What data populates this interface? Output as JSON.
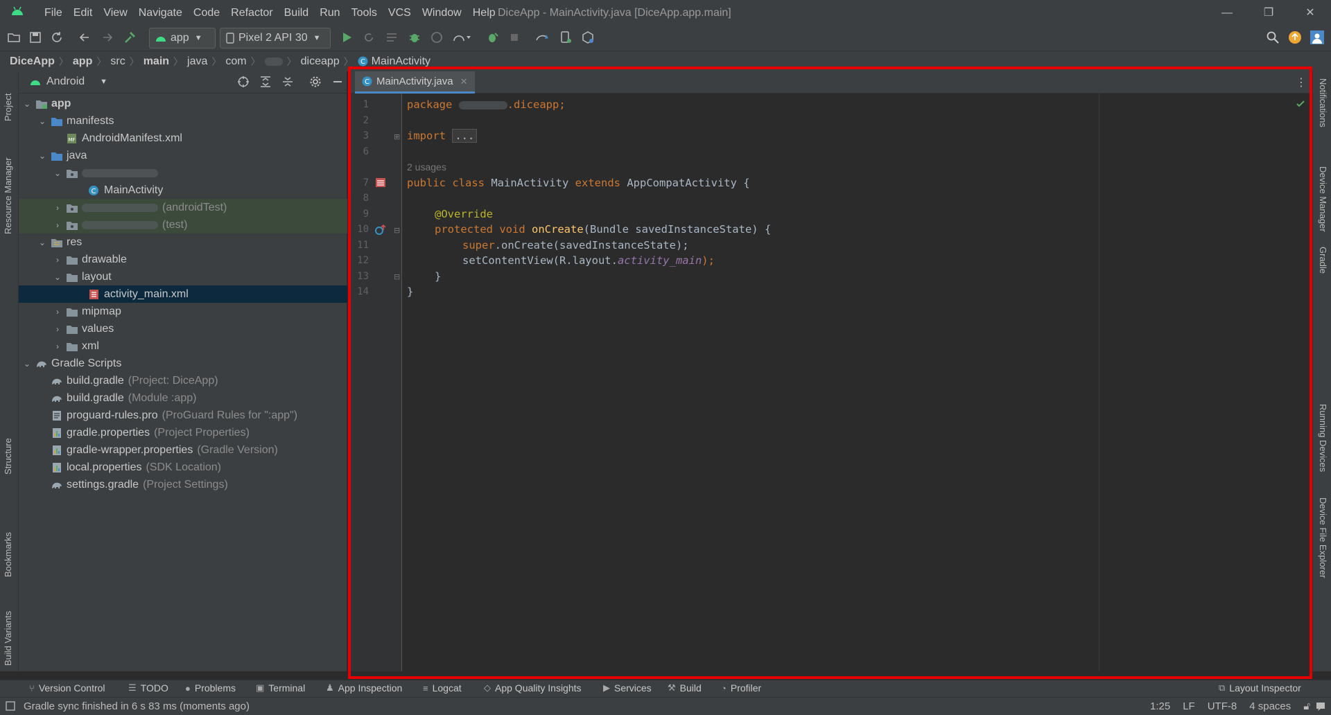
{
  "menu": [
    "File",
    "Edit",
    "View",
    "Navigate",
    "Code",
    "Refactor",
    "Build",
    "Run",
    "Tools",
    "VCS",
    "Window",
    "Help"
  ],
  "window_title": "DiceApp - MainActivity.java [DiceApp.app.main]",
  "toolbar": {
    "config": "app",
    "device": "Pixel 2 API 30"
  },
  "breadcrumb": [
    "DiceApp",
    "app",
    "src",
    "main",
    "java",
    "com",
    "",
    "diceapp",
    "MainActivity"
  ],
  "left_stripe": [
    "Project",
    "Resource Manager",
    "Structure",
    "Bookmarks",
    "Build Variants"
  ],
  "right_stripe": [
    "Notifications",
    "Device Manager",
    "Gradle",
    "Running Devices",
    "Device File Explorer"
  ],
  "project": {
    "view_label": "Android",
    "tree": [
      {
        "label": "app",
        "hint": "",
        "depth": 0
      },
      {
        "label": "manifests",
        "hint": "",
        "depth": 1
      },
      {
        "label": "AndroidManifest.xml",
        "hint": "",
        "depth": 2
      },
      {
        "label": "java",
        "hint": "",
        "depth": 1
      },
      {
        "label": "",
        "hint": "",
        "depth": 2
      },
      {
        "label": "MainActivity",
        "hint": "",
        "depth": 3
      },
      {
        "label": "",
        "hint": "(androidTest)",
        "depth": 2
      },
      {
        "label": "",
        "hint": "(test)",
        "depth": 2
      },
      {
        "label": "res",
        "hint": "",
        "depth": 1
      },
      {
        "label": "drawable",
        "hint": "",
        "depth": 2
      },
      {
        "label": "layout",
        "hint": "",
        "depth": 2
      },
      {
        "label": "activity_main.xml",
        "hint": "",
        "depth": 3
      },
      {
        "label": "mipmap",
        "hint": "",
        "depth": 2
      },
      {
        "label": "values",
        "hint": "",
        "depth": 2
      },
      {
        "label": "xml",
        "hint": "",
        "depth": 2
      },
      {
        "label": "Gradle Scripts",
        "hint": "",
        "depth": 0
      },
      {
        "label": "build.gradle",
        "hint": "(Project: DiceApp)",
        "depth": 1
      },
      {
        "label": "build.gradle",
        "hint": "(Module :app)",
        "depth": 1
      },
      {
        "label": "proguard-rules.pro",
        "hint": "(ProGuard Rules for \":app\")",
        "depth": 1
      },
      {
        "label": "gradle.properties",
        "hint": "(Project Properties)",
        "depth": 1
      },
      {
        "label": "gradle-wrapper.properties",
        "hint": "(Gradle Version)",
        "depth": 1
      },
      {
        "label": "local.properties",
        "hint": "(SDK Location)",
        "depth": 1
      },
      {
        "label": "settings.gradle",
        "hint": "(Project Settings)",
        "depth": 1
      }
    ]
  },
  "editor": {
    "tab": "MainActivity.java",
    "line_numbers": [
      "1",
      "2",
      "3",
      "6",
      "7",
      "8",
      "9",
      "10",
      "11",
      "12",
      "13",
      "14"
    ],
    "code": {
      "package_kw": "package",
      "package_rest": ".diceapp;",
      "import_kw": "import",
      "import_fold": "...",
      "usages": "2 usages",
      "class_decl_kw": "public class",
      "class_name": "MainActivity",
      "extends_kw": "extends",
      "class_rest": "AppCompatActivity {",
      "override": "@Override",
      "method_kw": "protected void",
      "method_name": "onCreate",
      "method_rest": "(Bundle savedInstanceState) {",
      "super_kw": "super",
      "super_rest": ".onCreate(savedInstanceState);",
      "set_content_a": "setContentView(R.layout.",
      "set_content_b": "activity_main",
      "set_content_c": ");",
      "close_method": "}",
      "close_class": "}"
    }
  },
  "bottom_tools": [
    "Version Control",
    "TODO",
    "Problems",
    "Terminal",
    "App Inspection",
    "Logcat",
    "App Quality Insights",
    "Services",
    "Build",
    "Profiler"
  ],
  "layout_inspector": "Layout Inspector",
  "status": {
    "message": "Gradle sync finished in 6 s 83 ms (moments ago)",
    "position": "1:25",
    "line_sep": "LF",
    "encoding": "UTF-8",
    "indent": "4 spaces"
  },
  "colors": {
    "highlight": "#e40000",
    "keyword": "#cc7832",
    "annotation": "#bbb529",
    "method": "#ffc66d"
  }
}
